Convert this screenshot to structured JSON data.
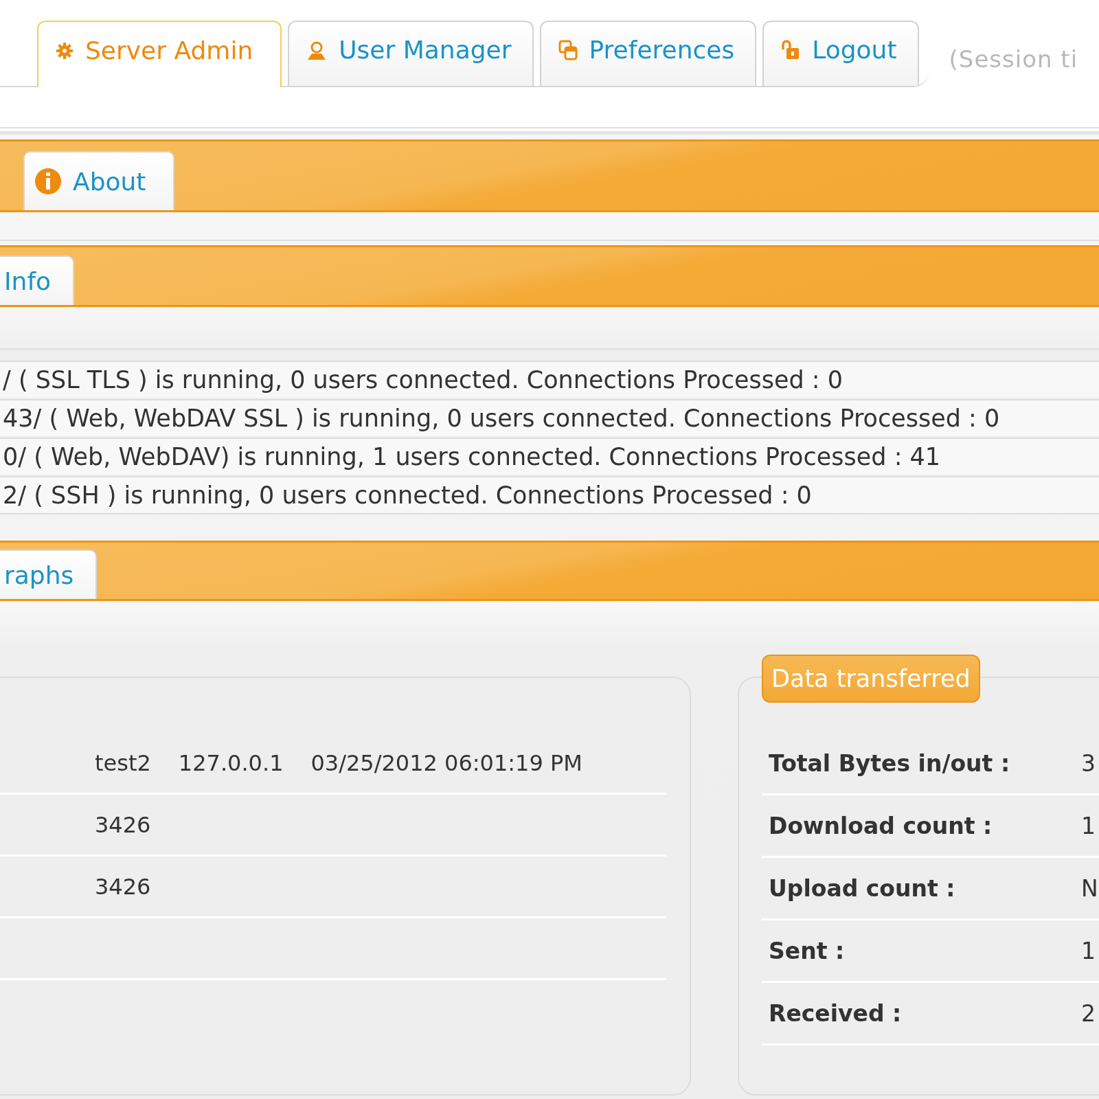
{
  "top_tabs": [
    {
      "label": "Server Admin",
      "kind": "gear",
      "selected": true
    },
    {
      "label": "User Manager",
      "kind": "user",
      "selected": false
    },
    {
      "label": "Preferences",
      "kind": "windows",
      "selected": false
    },
    {
      "label": "Logout",
      "kind": "padlock",
      "selected": false
    }
  ],
  "session_note": "(Session ti",
  "admin_tabs": [
    {
      "label": "About",
      "kind": "info"
    }
  ],
  "info_panel": {
    "tab": "Info",
    "rows": [
      "/ ( SSL TLS ) is running, 0 users connected. Connections Processed : 0",
      "43/ ( Web, WebDAV SSL ) is running, 0 users connected. Connections Processed : 0",
      "0/ ( Web, WebDAV) is running, 1 users connected. Connections Processed : 41",
      "2/ ( SSH ) is running, 0 users connected. Connections Processed : 0"
    ]
  },
  "graphs_panel": {
    "tab": "raphs",
    "session_box": {
      "rows": [
        {
          "cells": [
            "test2",
            "127.0.0.1",
            "03/25/2012 06:01:19 PM"
          ]
        },
        {
          "cells": [
            "3426"
          ]
        },
        {
          "cells": [
            "3426"
          ]
        }
      ]
    },
    "data_box": {
      "legend": "Data transferred",
      "rows": [
        {
          "label": "Total Bytes in/out :",
          "value": "3"
        },
        {
          "label": "Download count :",
          "value": "1"
        },
        {
          "label": "Upload count :",
          "value": "N"
        },
        {
          "label": "Sent :",
          "value": "1"
        },
        {
          "label": "Received :",
          "value": "2"
        }
      ]
    }
  }
}
